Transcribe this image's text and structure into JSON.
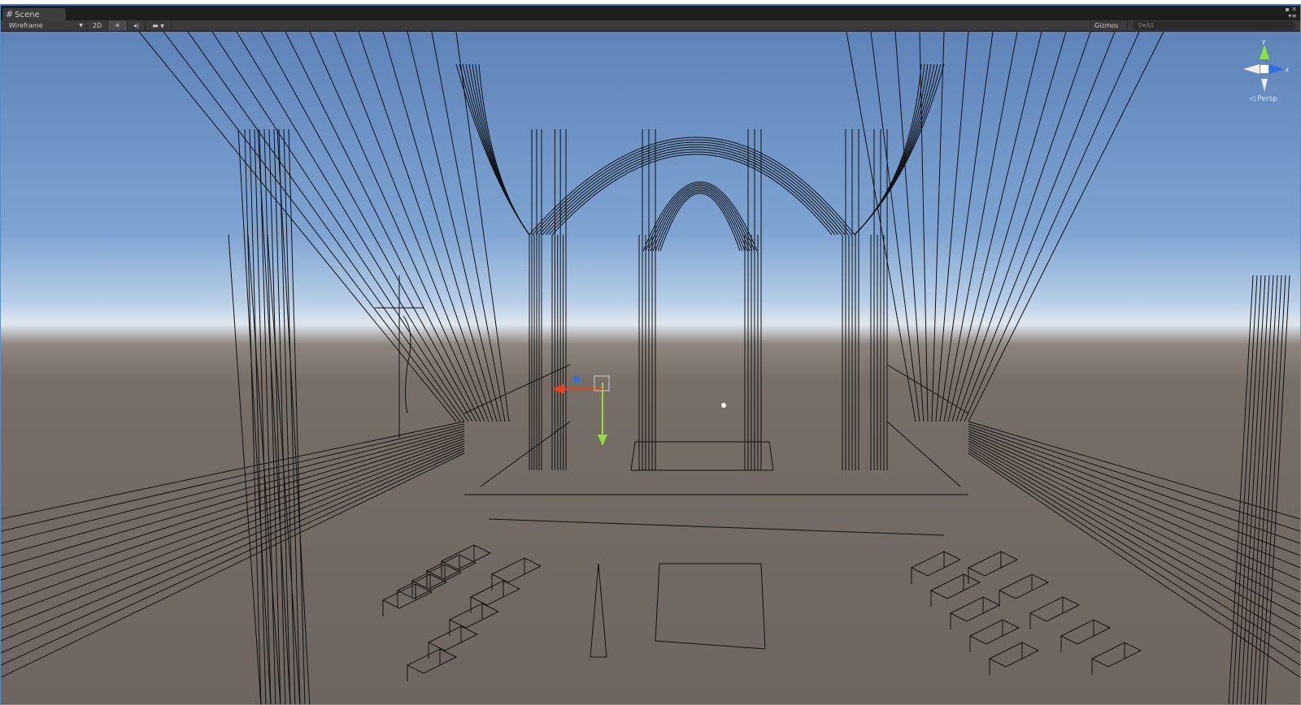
{
  "window": {
    "tab_label": "Scene",
    "tab_icon": "scene-grid-icon"
  },
  "toolbar": {
    "draw_mode": "Wireframe",
    "mode_2d": "2D",
    "gizmos": "Gizmos",
    "search_placeholder": "All"
  },
  "viewport": {
    "projection": "Persp",
    "axis_labels": {
      "y": "y",
      "z": "z"
    }
  },
  "colors": {
    "sky_top": "#5d83b8",
    "horizon": "#dfe7ee",
    "ground": "#6e6560",
    "axis_x": "#e8401c",
    "axis_y": "#8fe03a",
    "axis_z": "#2f6ee8"
  }
}
